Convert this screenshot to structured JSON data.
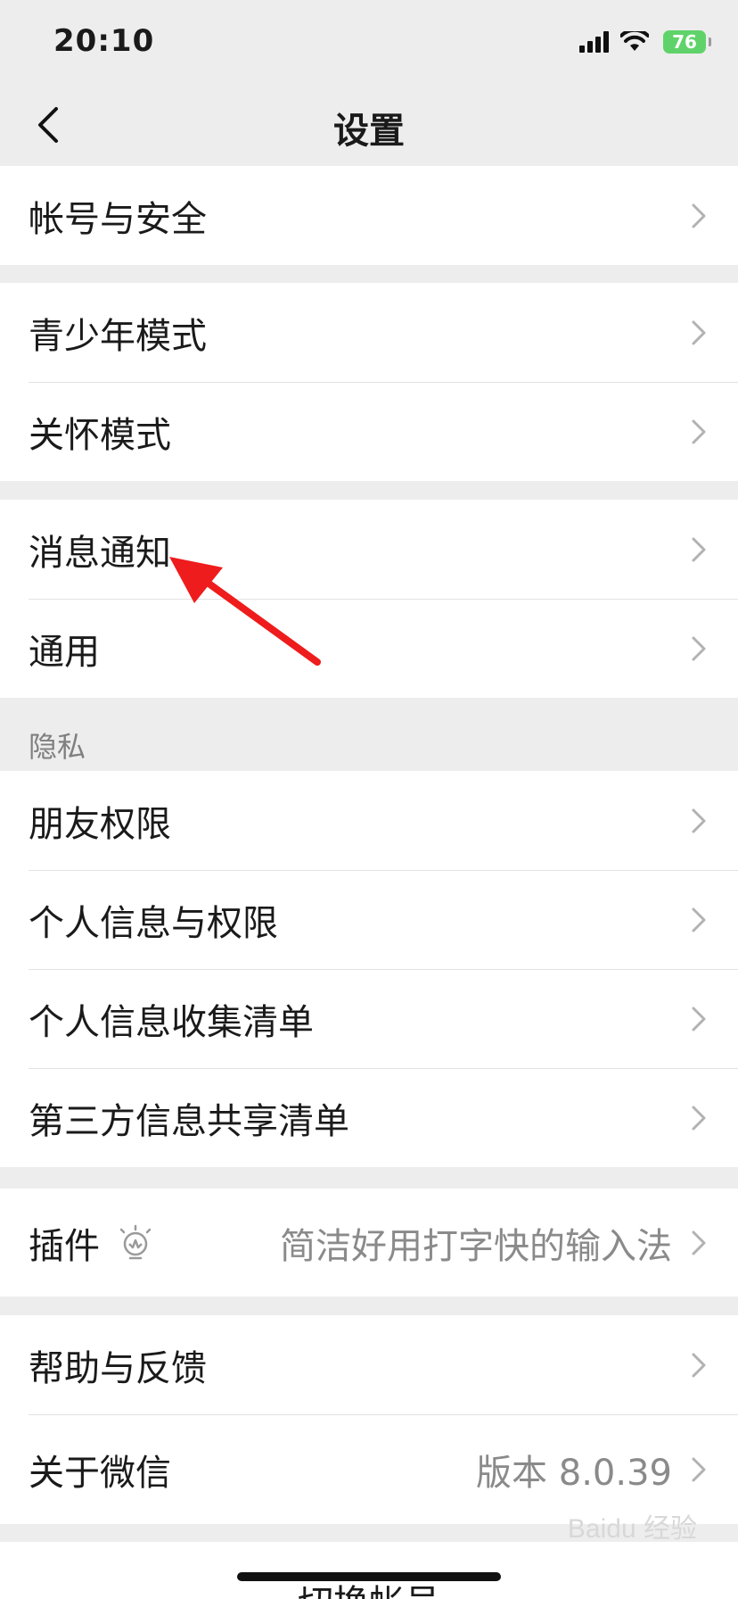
{
  "status_bar": {
    "time": "20:10",
    "battery": "76"
  },
  "nav": {
    "title": "设置"
  },
  "groups": [
    {
      "rows": [
        {
          "label": "帐号与安全"
        }
      ]
    },
    {
      "rows": [
        {
          "label": "青少年模式"
        },
        {
          "label": "关怀模式"
        }
      ]
    },
    {
      "rows": [
        {
          "label": "消息通知"
        },
        {
          "label": "通用"
        }
      ]
    },
    {
      "header": "隐私",
      "rows": [
        {
          "label": "朋友权限"
        },
        {
          "label": "个人信息与权限"
        },
        {
          "label": "个人信息收集清单"
        },
        {
          "label": "第三方信息共享清单"
        }
      ]
    },
    {
      "rows": [
        {
          "label": "插件",
          "value": "简洁好用打字快的输入法",
          "icon": "plugin-icon"
        }
      ]
    },
    {
      "rows": [
        {
          "label": "帮助与反馈"
        },
        {
          "label": "关于微信",
          "value": "版本 8.0.39"
        }
      ]
    }
  ],
  "footer": {
    "switch_account": "切换帐号"
  },
  "watermark": "Baidu 经验",
  "annotation": {
    "type": "red-arrow",
    "target": "消息通知",
    "color": "#ee1c1c"
  },
  "colors": {
    "background": "#ededed",
    "row_bg": "#ffffff",
    "secondary_text": "#8a8a8a"
  }
}
